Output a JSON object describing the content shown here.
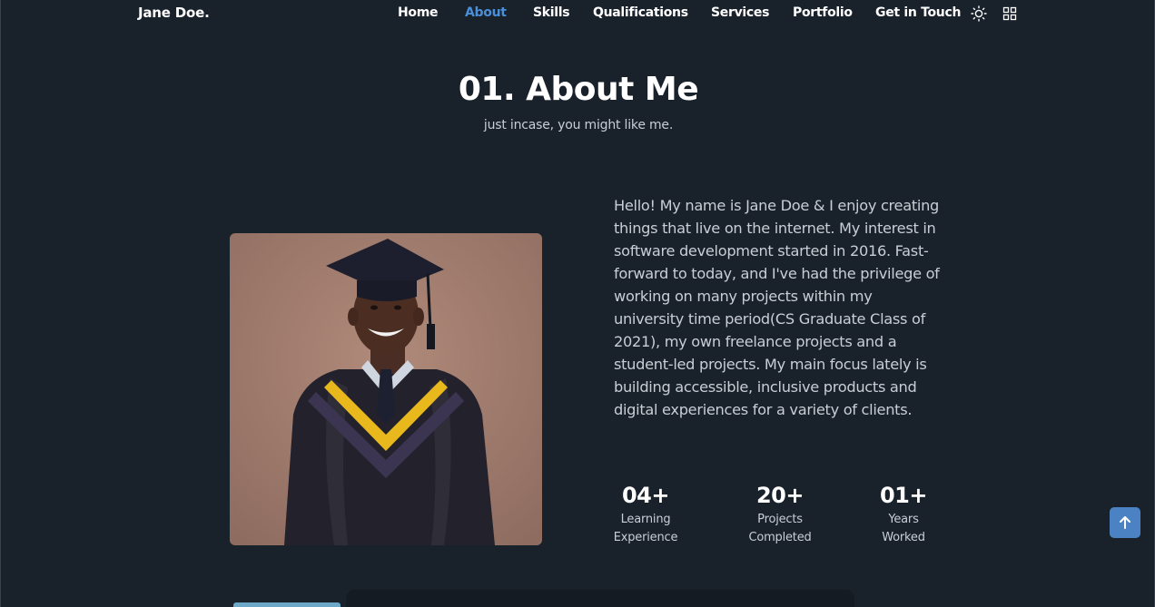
{
  "header": {
    "logo": "Jane Doe.",
    "nav": [
      {
        "label": "Home"
      },
      {
        "label": "About",
        "active": true
      },
      {
        "label": "Skills"
      },
      {
        "label": "Qualifications"
      },
      {
        "label": "Services"
      },
      {
        "label": "Portfolio"
      },
      {
        "label": "Get in Touch"
      }
    ],
    "icons": [
      "sun-icon",
      "grid-menu-icon"
    ]
  },
  "about": {
    "title": "01. About Me",
    "subtitle": "just incase, you might like me.",
    "bio": "Hello! My name is Jane Doe & I enjoy creating things that live on the internet. My interest in software development started in 2016. Fast-forward to today, and I've had the privilege of working on many projects within my university time period(CS Graduate Class of 2021), my own freelance projects and a student-led projects. My main focus lately is building accessible, inclusive products and digital experiences for a variety of clients.",
    "stats": [
      {
        "number": "04+",
        "label_line1": "Learning",
        "label_line2": "Experience"
      },
      {
        "number": "20+",
        "label_line1": "Projects",
        "label_line2": "Completed"
      },
      {
        "number": "01+",
        "label_line1": "Years",
        "label_line2": "Worked"
      }
    ]
  },
  "colors": {
    "background": "#19212b",
    "accent": "#4a90d9",
    "scroll_button": "#4a82c4"
  }
}
